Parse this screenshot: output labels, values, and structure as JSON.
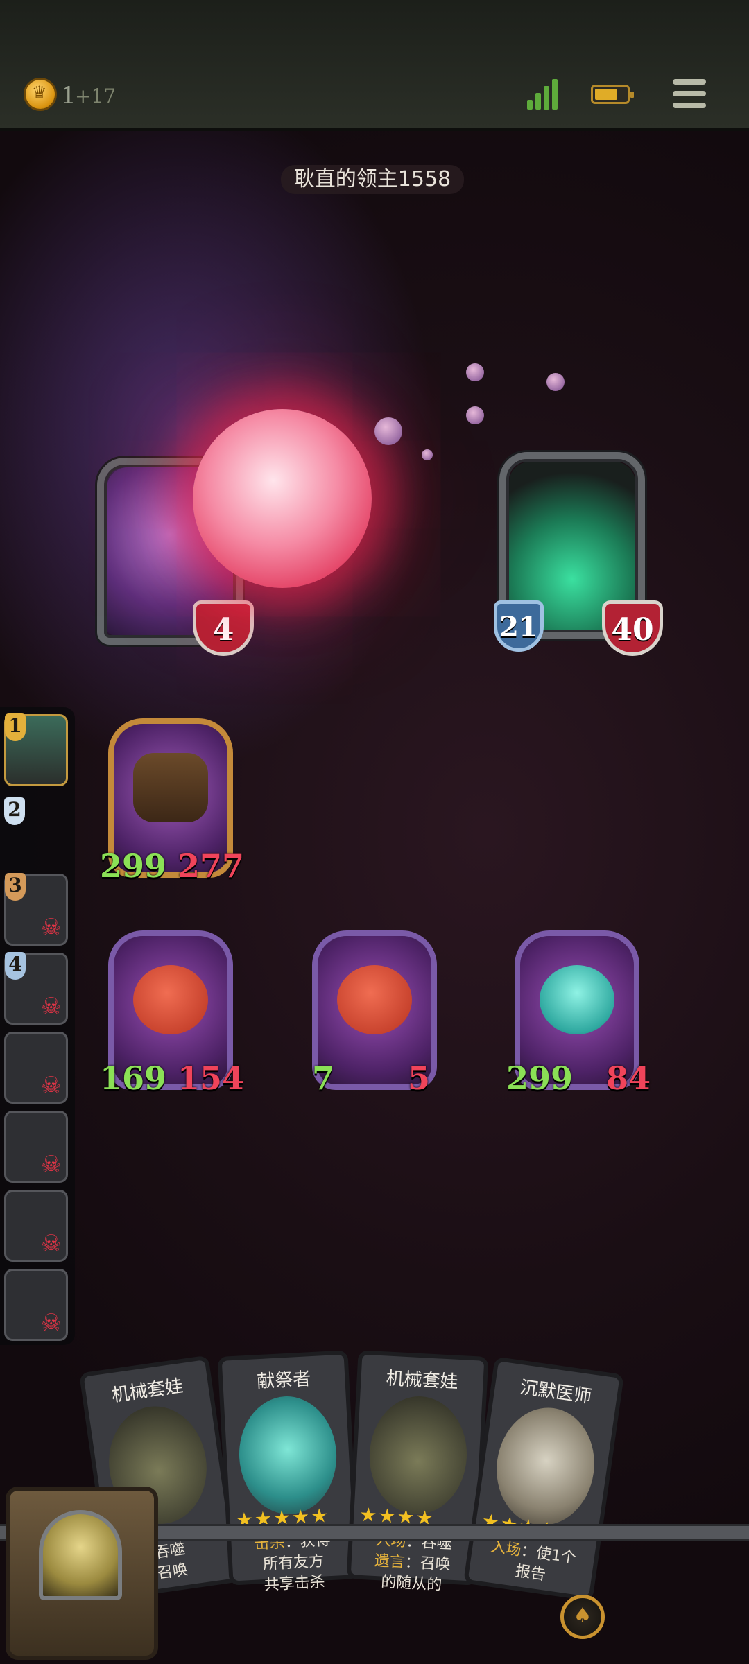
{
  "top_bar": {
    "coin_count": "1",
    "coin_bonus": "+17",
    "icons": [
      "coin-icon",
      "signal-icon",
      "battery-icon",
      "menu-icon"
    ]
  },
  "opponent": {
    "name": "耿直的领主1558",
    "hero_left_health": "4",
    "hero_right_armor": "21",
    "hero_right_health": "40"
  },
  "turn_queue": [
    {
      "number": "1",
      "state": "active"
    },
    {
      "number": "2",
      "state": "empty"
    },
    {
      "number": "3",
      "state": "defeated"
    },
    {
      "number": "4",
      "state": "defeated"
    },
    {
      "number": "",
      "state": "defeated"
    },
    {
      "number": "",
      "state": "defeated"
    },
    {
      "number": "",
      "state": "defeated"
    },
    {
      "number": "",
      "state": "defeated"
    }
  ],
  "board": {
    "front_minion": {
      "attack": "299",
      "health": "277"
    },
    "row": [
      {
        "attack": "169",
        "health": "154"
      },
      {
        "attack": "7",
        "health": "5"
      },
      {
        "attack": "299",
        "health": "84"
      }
    ]
  },
  "hand": [
    {
      "title": "机械套娃",
      "stars": "★★★",
      "text_a": "吞噬",
      "text_b": "召唤"
    },
    {
      "title": "献祭者",
      "stars": "★★★★★",
      "kw1": "击杀",
      "text_a": "：获得",
      "text_b": "所有友方",
      "text_c": "共享击杀"
    },
    {
      "title": "机械套娃",
      "stars": "★★★★",
      "kw1": "入场",
      "text_a": "：吞噬",
      "kw2": "遗言",
      "text_b": "：召唤",
      "text_c": "的随从的"
    },
    {
      "title": "沉默医师",
      "stars": "★★★★★",
      "kw1": "入场",
      "text_a": "：使1个",
      "text_b": "报告"
    }
  ],
  "colors": {
    "attack": "#8be056",
    "health": "#f0445a",
    "gold": "#c9922f"
  }
}
